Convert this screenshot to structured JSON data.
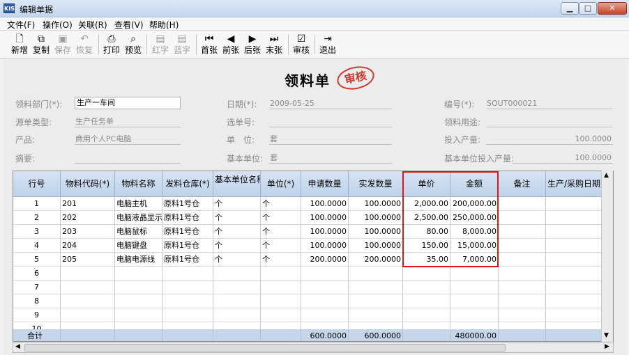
{
  "window": {
    "title": "编辑单据",
    "app_icon": "KIS"
  },
  "menu": [
    {
      "label": "文件(F)"
    },
    {
      "label": "操作(O)"
    },
    {
      "label": "关联(R)"
    },
    {
      "label": "查看(V)"
    },
    {
      "label": "帮助(H)"
    }
  ],
  "toolbar": [
    {
      "label": "新增",
      "icon": "new-document-icon",
      "disabled": false
    },
    {
      "label": "复制",
      "icon": "copy-icon",
      "disabled": false
    },
    {
      "label": "保存",
      "icon": "save-icon",
      "disabled": true
    },
    {
      "label": "恢复",
      "icon": "undo-icon",
      "disabled": true
    },
    {
      "label": "打印",
      "icon": "print-icon",
      "disabled": false
    },
    {
      "label": "预览",
      "icon": "preview-icon",
      "disabled": false
    },
    {
      "label": "红字",
      "icon": "red-text-icon",
      "disabled": true
    },
    {
      "label": "蓝字",
      "icon": "blue-text-icon",
      "disabled": true
    },
    {
      "label": "首张",
      "icon": "first-icon",
      "disabled": false
    },
    {
      "label": "前张",
      "icon": "previous-icon",
      "disabled": false
    },
    {
      "label": "后张",
      "icon": "next-icon",
      "disabled": false
    },
    {
      "label": "末张",
      "icon": "last-icon",
      "disabled": false
    },
    {
      "label": "审核",
      "icon": "audit-icon",
      "disabled": false
    },
    {
      "label": "退出",
      "icon": "exit-icon",
      "disabled": false
    }
  ],
  "document": {
    "title": "领料单",
    "stamp": "审核"
  },
  "fields": {
    "dept": {
      "label": "领料部门(*):",
      "value": "生产一车间"
    },
    "date": {
      "label": "日期(*):",
      "value": "2009-05-25"
    },
    "number": {
      "label": "编号(*):",
      "value": "SOUT000021"
    },
    "source_type": {
      "label": "源单类型:",
      "value": "生产任务单"
    },
    "source_no": {
      "label": "选单号:",
      "value": ""
    },
    "purpose": {
      "label": "领料用途:",
      "value": ""
    },
    "product": {
      "label": "产品:",
      "value": "商用个人PC电脑"
    },
    "unit": {
      "label": "单　位:",
      "value": "套"
    },
    "input_qty": {
      "label": "投入产量:",
      "value": "100.0000"
    },
    "summary": {
      "label": "摘要:",
      "value": ""
    },
    "base_unit": {
      "label": "基本单位:",
      "value": "套"
    },
    "base_input_qty": {
      "label": "基本单位投入产量:",
      "value": "100.0000"
    }
  },
  "table": {
    "headers": [
      "行号",
      "物料代码(*)",
      "物料名称",
      "发料仓库(*)",
      "基本单位名称",
      "单位(*)",
      "申请数量",
      "实发数量",
      "单价",
      "金额",
      "备注",
      "生产/采购日期"
    ],
    "rows": [
      [
        "1",
        "201",
        "电脑主机",
        "原料1号仓",
        "个",
        "个",
        "100.0000",
        "100.0000",
        "2,000.00",
        "200,000.00",
        "",
        ""
      ],
      [
        "2",
        "202",
        "电脑液晶显示",
        "原料1号仓",
        "个",
        "个",
        "100.0000",
        "100.0000",
        "2,500.00",
        "250,000.00",
        "",
        ""
      ],
      [
        "3",
        "203",
        "电脑鼠标",
        "原料1号仓",
        "个",
        "个",
        "100.0000",
        "100.0000",
        "80.00",
        "8,000.00",
        "",
        ""
      ],
      [
        "4",
        "204",
        "电脑键盘",
        "原料1号仓",
        "个",
        "个",
        "100.0000",
        "100.0000",
        "150.00",
        "15,000.00",
        "",
        ""
      ],
      [
        "5",
        "205",
        "电脑电源线",
        "原料1号仓",
        "个",
        "个",
        "200.0000",
        "200.0000",
        "35.00",
        "7,000.00",
        "",
        ""
      ],
      [
        "6",
        "",
        "",
        "",
        "",
        "",
        "",
        "",
        "",
        "",
        "",
        ""
      ],
      [
        "7",
        "",
        "",
        "",
        "",
        "",
        "",
        "",
        "",
        "",
        "",
        ""
      ],
      [
        "8",
        "",
        "",
        "",
        "",
        "",
        "",
        "",
        "",
        "",
        "",
        ""
      ],
      [
        "9",
        "",
        "",
        "",
        "",
        "",
        "",
        "",
        "",
        "",
        "",
        ""
      ],
      [
        "10",
        "",
        "",
        "",
        "",
        "",
        "",
        "",
        "",
        "",
        "",
        ""
      ]
    ],
    "total": [
      "合计",
      "",
      "",
      "",
      "",
      "",
      "600.0000",
      "600.0000",
      "",
      "480000.00",
      "",
      ""
    ]
  },
  "colors": {
    "highlight": "#e01515",
    "stamp": "#d1352b",
    "header_bg": "#c9d9ee"
  }
}
